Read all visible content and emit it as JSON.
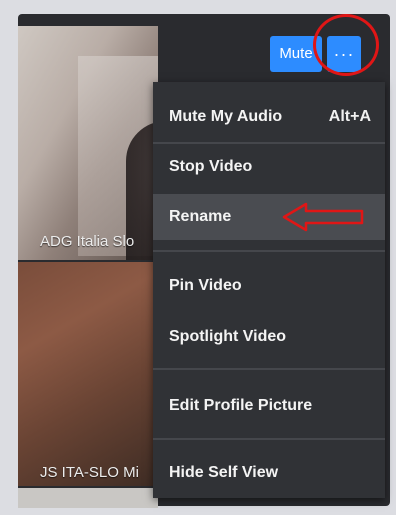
{
  "tiles": {
    "top_name": "ADG Italia Slo",
    "bottom_name": "JS ITA-SLO Mi"
  },
  "controls": {
    "mute_label": "Mute",
    "more_label": "···"
  },
  "menu": {
    "items": [
      {
        "label": "Mute My Audio",
        "shortcut": "Alt+A"
      },
      {
        "label": "Stop Video"
      },
      {
        "label": "Rename"
      },
      {
        "label": "Pin Video"
      },
      {
        "label": "Spotlight Video"
      },
      {
        "label": "Edit Profile Picture"
      },
      {
        "label": "Hide Self View"
      }
    ]
  },
  "annotations": {
    "circle_color": "#e01616",
    "arrow_color": "#e01616"
  },
  "colors": {
    "accent": "#2d8cff",
    "menu_bg": "#303236"
  }
}
